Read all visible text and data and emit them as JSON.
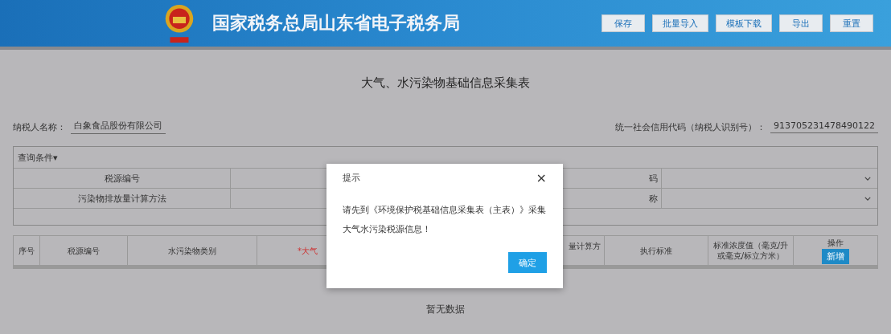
{
  "header": {
    "title": "国家税务总局山东省电子税务局",
    "buttons": [
      "保存",
      "批量导入",
      "模板下载",
      "导出",
      "重置"
    ]
  },
  "form": {
    "title": "大气、水污染物基础信息采集表",
    "taxpayer_label": "纳税人名称：",
    "taxpayer_value": "白象食品股份有限公司",
    "code_label": "统一社会信用代码（纳税人识别号）：",
    "code_value": "913705231478490122"
  },
  "query": {
    "toggle": "查询条件▾",
    "rows": [
      {
        "label": "税源编号",
        "label_2": "码"
      },
      {
        "label": "污染物排放量计算方法",
        "label_2": "称"
      }
    ]
  },
  "table": {
    "columns": [
      "序号",
      "税源编号",
      "水污染物类别",
      "*大气",
      "量计算方",
      "执行标准",
      "标准浓度值（毫克/升或毫克/标立方米）",
      "操作"
    ],
    "add_button": "新增",
    "empty": "暂无数据"
  },
  "dialog": {
    "title": "提示",
    "close": "×",
    "message": "请先到《环境保护税基础信息采集表（主表）》采集大气水污染税源信息！",
    "ok": "确定"
  }
}
